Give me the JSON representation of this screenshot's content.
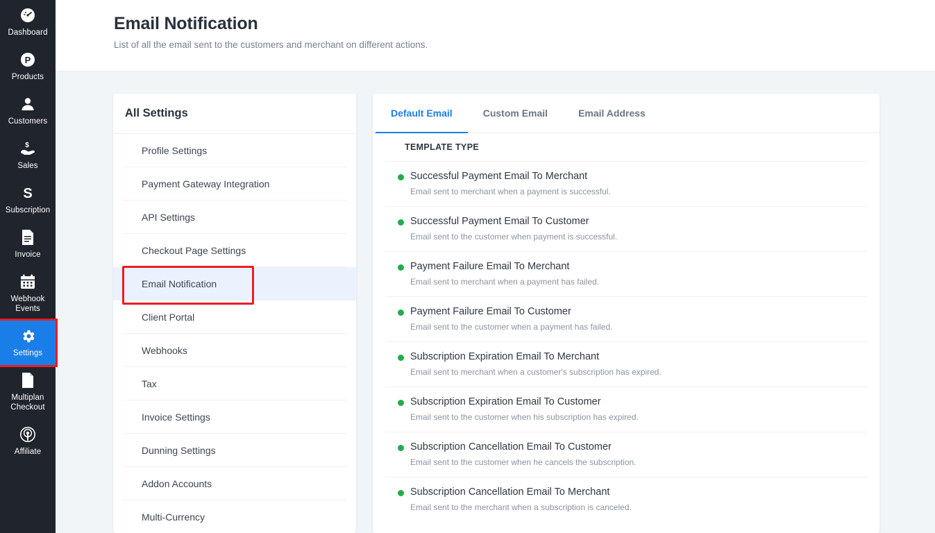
{
  "sidebar": {
    "items": [
      {
        "label": "Dashboard",
        "icon": "gauge-icon",
        "active": false
      },
      {
        "label": "Products",
        "icon": "product-circle-p-icon",
        "active": false
      },
      {
        "label": "Customers",
        "icon": "user-icon",
        "active": false
      },
      {
        "label": "Sales",
        "icon": "hand-money-icon",
        "active": false
      },
      {
        "label": "Subscription",
        "icon": "letter-s-icon",
        "active": false
      },
      {
        "label": "Invoice",
        "icon": "document-lines-icon",
        "active": false
      },
      {
        "label": "Webhook Events",
        "icon": "calendar-icon",
        "active": false
      },
      {
        "label": "Settings",
        "icon": "gear-icon",
        "active": true
      },
      {
        "label": "Multiplan Checkout",
        "icon": "page-icon",
        "active": false
      },
      {
        "label": "Affiliate",
        "icon": "broadcast-icon",
        "active": false
      }
    ]
  },
  "header": {
    "title": "Email Notification",
    "subtitle": "List of all the email sent to the customers and merchant on different actions."
  },
  "settings_panel": {
    "heading": "All Settings",
    "items": [
      {
        "label": "Profile Settings",
        "selected": false
      },
      {
        "label": "Payment Gateway Integration",
        "selected": false
      },
      {
        "label": "API Settings",
        "selected": false
      },
      {
        "label": "Checkout Page Settings",
        "selected": false
      },
      {
        "label": "Email Notification",
        "selected": true
      },
      {
        "label": "Client Portal",
        "selected": false
      },
      {
        "label": "Webhooks",
        "selected": false
      },
      {
        "label": "Tax",
        "selected": false
      },
      {
        "label": "Invoice Settings",
        "selected": false
      },
      {
        "label": "Dunning Settings",
        "selected": false
      },
      {
        "label": "Addon Accounts",
        "selected": false
      },
      {
        "label": "Multi-Currency",
        "selected": false
      }
    ]
  },
  "email_panel": {
    "tabs": [
      {
        "label": "Default Email",
        "active": true
      },
      {
        "label": "Custom Email",
        "active": false
      },
      {
        "label": "Email Address",
        "active": false
      }
    ],
    "column_header": "TEMPLATE TYPE",
    "templates": [
      {
        "title": "Successful Payment Email To Merchant",
        "description": "Email sent to merchant when a payment is successful.",
        "status_color": "#22ac4b"
      },
      {
        "title": "Successful Payment Email To Customer",
        "description": "Email sent to the customer when payment is successful.",
        "status_color": "#22ac4b"
      },
      {
        "title": "Payment Failure Email To Merchant",
        "description": "Email sent to merchant when a payment has failed.",
        "status_color": "#22ac4b"
      },
      {
        "title": "Payment Failure Email To Customer",
        "description": "Email sent to the customer when a payment has failed.",
        "status_color": "#22ac4b"
      },
      {
        "title": "Subscription Expiration Email To Merchant",
        "description": "Email sent to merchant when a customer's subscription has expired.",
        "status_color": "#22ac4b"
      },
      {
        "title": "Subscription Expiration Email To Customer",
        "description": "Email sent to the customer when his subscription has expired.",
        "status_color": "#22ac4b"
      },
      {
        "title": "Subscription Cancellation Email To Customer",
        "description": "Email sent to the customer when he cancels the subscription.",
        "status_color": "#22ac4b"
      },
      {
        "title": "Subscription Cancellation Email To Merchant",
        "description": "Email sent to the merchant when a subscription is canceled.",
        "status_color": "#22ac4b"
      }
    ]
  },
  "colors": {
    "accent_blue": "#1a7ee8",
    "sidebar_bg": "#20242c",
    "page_bg": "#f1f5f8",
    "annotation_red": "#ec1c24",
    "status_green": "#22ac4b"
  }
}
